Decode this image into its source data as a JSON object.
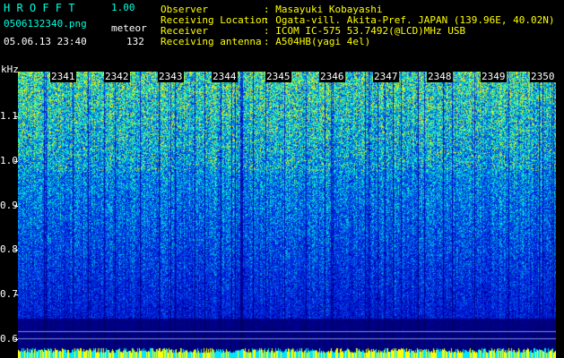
{
  "app": {
    "title": "H R O F F T",
    "version": "1.00"
  },
  "file": {
    "name": "0506132340.png",
    "datetime": "05.06.13 23:40",
    "mode_label": "meteor",
    "count": "132"
  },
  "info": [
    {
      "label": "Observer",
      "value": ": Masayuki Kobayashi"
    },
    {
      "label": "Receiving Location",
      "value": ": Ogata-vill. Akita-Pref. JAPAN (139.96E, 40.02N)"
    },
    {
      "label": "Receiver",
      "value": ": ICOM IC-575 53.7492(@LCD)MHz USB"
    },
    {
      "label": "Receiving antenna",
      "value": ": A504HB(yagi 4el)"
    }
  ],
  "axis": {
    "y_unit": "kHz",
    "y_ticks": [
      "1.1",
      "1.0",
      "0.9",
      "0.8",
      "0.7",
      "0.6"
    ],
    "x_ticks": [
      "2341",
      "2342",
      "2343",
      "2344",
      "2345",
      "2346",
      "2347",
      "2348",
      "2349",
      "2350"
    ]
  },
  "colors": {
    "title": "#00ffe0",
    "labels": "#ffff00",
    "text": "#ffffff",
    "background": "#000000"
  }
}
